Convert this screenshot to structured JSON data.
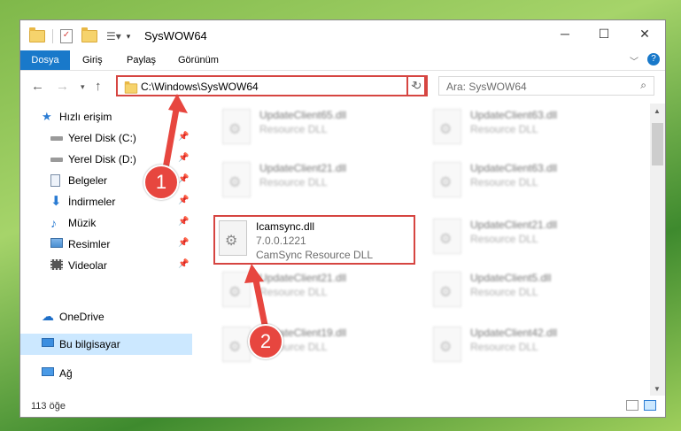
{
  "window": {
    "title": "SysWOW64",
    "controls": [
      "─",
      "☐",
      "✕"
    ]
  },
  "ribbon": {
    "tabs": [
      "Dosya",
      "Giriş",
      "Paylaş",
      "Görünüm"
    ],
    "active_tab": "Dosya",
    "accent": "#1979ca"
  },
  "address": {
    "path": "C:\\Windows\\SysWOW64",
    "search_placeholder": "Ara: SysWOW64"
  },
  "sidebar": {
    "quick_access": "Hızlı erişim",
    "items": [
      {
        "label": "Yerel Disk (C:)",
        "icon": "drive-icon"
      },
      {
        "label": "Yerel Disk (D:)",
        "icon": "drive-icon"
      },
      {
        "label": "Belgeler",
        "icon": "documents-icon"
      },
      {
        "label": "İndirmeler",
        "icon": "download-icon"
      },
      {
        "label": "Müzik",
        "icon": "music-icon"
      },
      {
        "label": "Resimler",
        "icon": "pictures-icon"
      },
      {
        "label": "Videolar",
        "icon": "videos-icon"
      }
    ],
    "onedrive": "OneDrive",
    "this_pc": "Bu bilgisayar",
    "network": "Ağ"
  },
  "files": {
    "highlighted": {
      "name": "Icamsync.dll",
      "version": "7.0.0.1221",
      "description": "CamSync Resource DLL"
    },
    "blurred_left": [
      {
        "name": "UpdateClient65.dll",
        "desc": "Resource DLL"
      },
      {
        "name": "UpdateClient21.dll",
        "desc": "Resource DLL"
      },
      {
        "name": "UpdateClient21.dll",
        "desc": "Resource DLL"
      },
      {
        "name": "UpdateClient19.dll",
        "desc": "Resource DLL"
      }
    ],
    "blurred_right": [
      {
        "name": "UpdateClient63.dll",
        "desc": "Resource DLL"
      },
      {
        "name": "UpdateClient63.dll",
        "desc": "Resource DLL"
      },
      {
        "name": "UpdateClient21.dll",
        "desc": "Resource DLL"
      },
      {
        "name": "UpdateClient5.dll",
        "desc": "Resource DLL"
      },
      {
        "name": "UpdateClient42.dll",
        "desc": "Resource DLL"
      }
    ]
  },
  "status": {
    "count": "113 öğe"
  },
  "callouts": [
    "1",
    "2"
  ],
  "callout_color": "#e7463f"
}
